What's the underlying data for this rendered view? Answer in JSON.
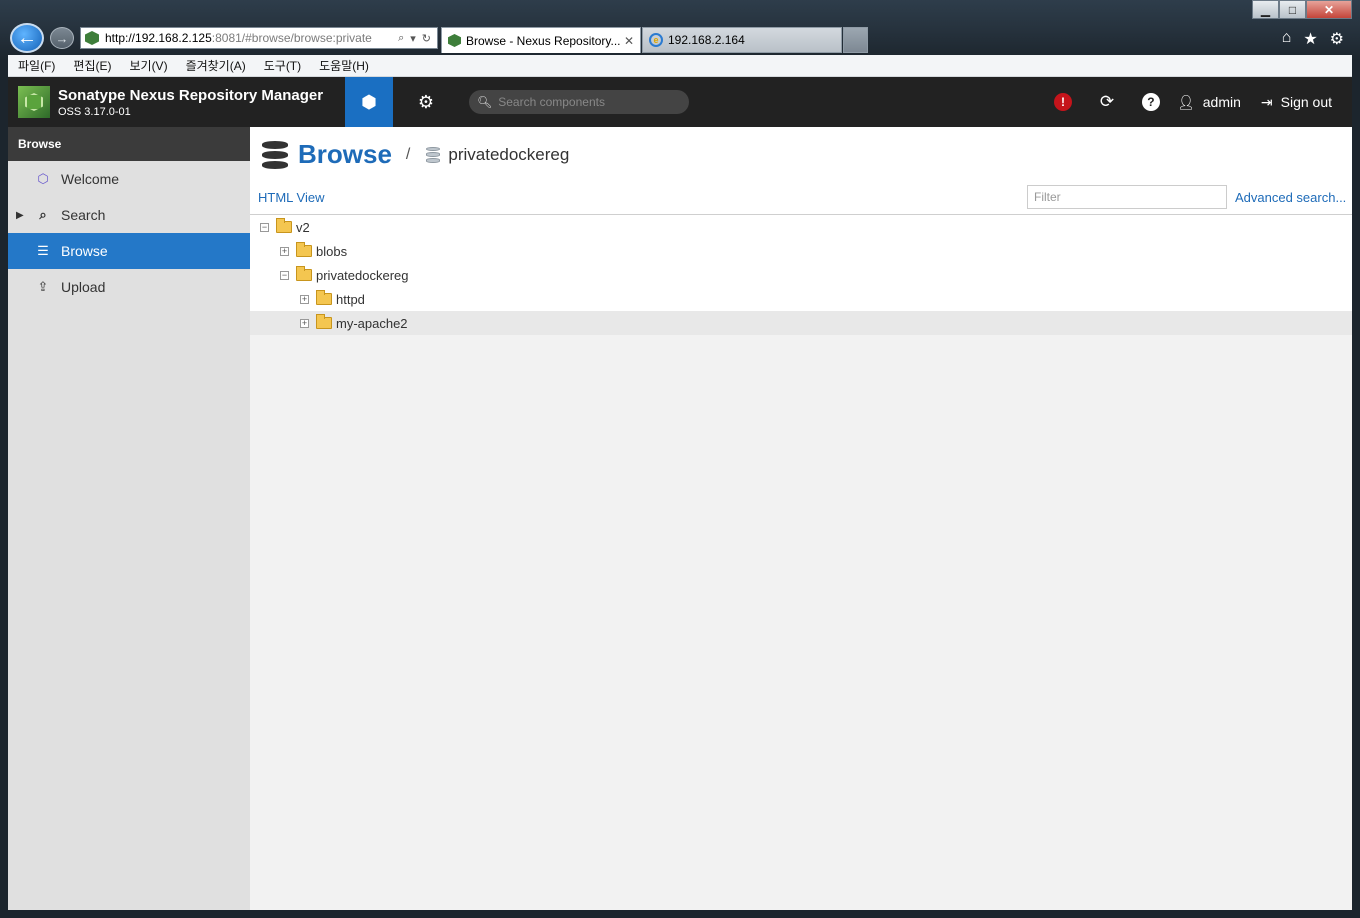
{
  "browser": {
    "address_host": "http://192.168.2.125",
    "address_rest": ":8081/#browse/browse:private",
    "tabs": [
      {
        "label": "Browse - Nexus Repository...",
        "close": "✕"
      },
      {
        "label": "192.168.2.164"
      }
    ],
    "menu": [
      "파일(F)",
      "편집(E)",
      "보기(V)",
      "즐겨찾기(A)",
      "도구(T)",
      "도움말(H)"
    ]
  },
  "header": {
    "title": "Sonatype Nexus Repository Manager",
    "version": "OSS 3.17.0-01",
    "search_placeholder": "Search components",
    "user": "admin",
    "signout": "Sign out"
  },
  "sidebar": {
    "heading": "Browse",
    "items": [
      {
        "label": "Welcome",
        "icon": "hexagon-icon"
      },
      {
        "label": "Search",
        "icon": "search-icon"
      },
      {
        "label": "Browse",
        "icon": "database-icon"
      },
      {
        "label": "Upload",
        "icon": "upload-icon"
      }
    ]
  },
  "main": {
    "title": "Browse",
    "separator": "/",
    "repo": "privatedockereg",
    "html_view": "HTML View",
    "filter_placeholder": "Filter",
    "advanced_search": "Advanced search..."
  },
  "tree": [
    {
      "label": "v2",
      "expanded": true,
      "depth": 0
    },
    {
      "label": "blobs",
      "expanded": false,
      "depth": 1
    },
    {
      "label": "privatedockereg",
      "expanded": true,
      "depth": 1
    },
    {
      "label": "httpd",
      "expanded": false,
      "depth": 2
    },
    {
      "label": "my-apache2",
      "expanded": false,
      "depth": 2,
      "selected": true
    }
  ],
  "colors": {
    "accent": "#1e6bb8",
    "sidebar_selected": "#2478c8",
    "header_bg": "#222222",
    "alert": "#c5141b"
  }
}
